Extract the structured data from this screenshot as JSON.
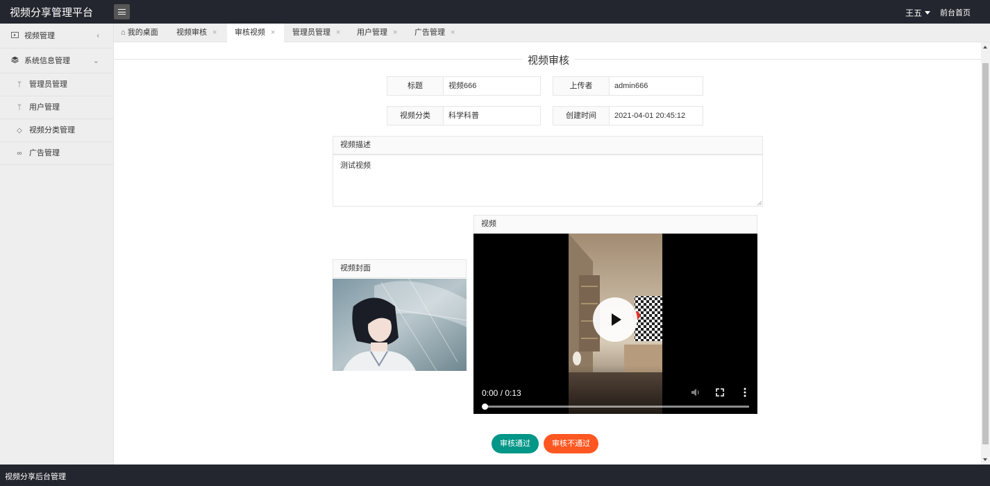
{
  "app": {
    "title": "视频分享管理平台",
    "user": "王五",
    "front_link": "前台首页",
    "footer": "视频分享后台管理"
  },
  "sidebar": {
    "items": [
      {
        "label": "视频管理",
        "icon": "video-icon"
      },
      {
        "label": "系统信息管理",
        "icon": "layers-icon"
      },
      {
        "label": "管理员管理",
        "icon": "admin-user-icon"
      },
      {
        "label": "用户管理",
        "icon": "users-icon"
      },
      {
        "label": "视频分类管理",
        "icon": "tag-icon"
      },
      {
        "label": "广告管理",
        "icon": "link-icon"
      }
    ]
  },
  "tabs": [
    {
      "label": "我的桌面",
      "icon": "home-icon"
    },
    {
      "label": "视频审核"
    },
    {
      "label": "审核视频",
      "active": true
    },
    {
      "label": "管理员管理"
    },
    {
      "label": "用户管理"
    },
    {
      "label": "广告管理"
    }
  ],
  "form": {
    "heading": "视频审核",
    "title_label": "标题",
    "title_value": "视频666",
    "uploader_label": "上传者",
    "uploader_value": "admin666",
    "category_label": "视频分类",
    "category_value": "科学科普",
    "created_label": "创建时间",
    "created_value": "2021-04-01 20:45:12",
    "description_label": "视频描述",
    "description_value": "测试视频",
    "cover_label": "视频封面",
    "video_label": "视频"
  },
  "video": {
    "time": "0:00 / 0:13",
    "progress": 0
  },
  "actions": {
    "approve": "审核通过",
    "reject": "审核不通过"
  },
  "colors": {
    "header_bg": "#23262e",
    "approve": "#009688",
    "reject": "#ff5722"
  }
}
